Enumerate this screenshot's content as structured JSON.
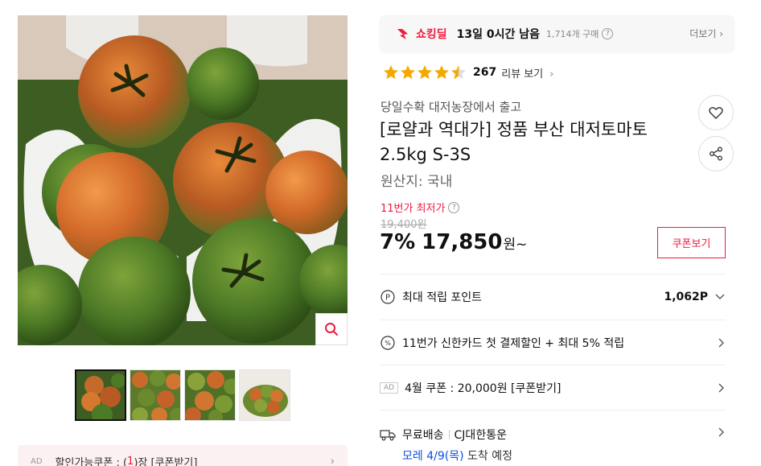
{
  "gallery": {
    "zoom_icon": "search-icon",
    "thumbnail_count": 4,
    "active_thumbnail": 1
  },
  "ad_coupon": {
    "ad_label": "AD",
    "text_before": "할인가능쿠폰 : (",
    "count": "1",
    "text_after": ")장 [쿠폰받기]"
  },
  "deal": {
    "logo_label": "쇼킹딜",
    "remaining": "13일 0시간 남음",
    "purchase_count": "1,714개 구매",
    "more_label": "더보기"
  },
  "rating": {
    "stars": 4.5,
    "count": "267",
    "link_label": "리뷰 보기"
  },
  "product": {
    "seller_note": "당일수확 대저농장에서 출고",
    "title": "[로얄과 역대가] 정품 부산 대저토마토 2.5kg S-3S",
    "origin": "원산지:  국내"
  },
  "price": {
    "lowest_label": "11번가 최저가",
    "original": "19,400원",
    "discount": "7%",
    "sale": "17,850",
    "unit": "원~",
    "coupon_button": "쿠폰보기"
  },
  "benefits": {
    "points_label": "최대 적립 포인트",
    "points_value": "1,062P",
    "card_label": "11번가 신한카드 첫 결제할인 + 최대 5% 적립",
    "ad_label": "AD",
    "coupon_label": "4월 쿠폰 : 20,000원 [쿠폰받기]",
    "ship_label": "무료배송",
    "ship_carrier": "CJ대한통운",
    "ship_date_prefix": "모레 4/9(목)",
    "ship_date_suffix": " 도착 예정"
  },
  "colors": {
    "accent": "#f01a3d",
    "star": "#f5a800",
    "link_blue": "#0b4ee5"
  }
}
